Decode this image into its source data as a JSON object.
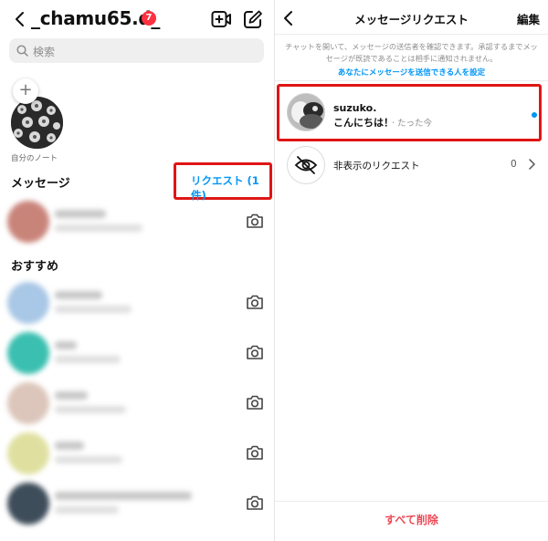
{
  "left_panel": {
    "username": "_chamu65.d_",
    "notification_count": "7",
    "search_placeholder": "検索",
    "note_label": "自分のノート",
    "messages_heading": "メッセージ",
    "requests_link": "リクエスト (1件)",
    "recommended_heading": "おすすめ",
    "message_rows": [
      {
        "avatar_color": "#c9847a",
        "name_width": 56,
        "msg_width": 96
      }
    ],
    "recommended_rows": [
      {
        "avatar_color": "#a9c7e6",
        "name_width": 52,
        "msg_width": 84
      },
      {
        "avatar_color": "#3bbfb0",
        "name_width": 24,
        "msg_width": 72
      },
      {
        "avatar_color": "#dcc6bb",
        "name_width": 36,
        "msg_width": 78
      },
      {
        "avatar_color": "#dfe0a0",
        "name_width": 32,
        "msg_width": 74
      },
      {
        "avatar_color": "#3e4d5a",
        "name_width": 150,
        "msg_width": 70
      }
    ]
  },
  "right_panel": {
    "title": "メッセージリクエスト",
    "edit_label": "編集",
    "info_text": "チャットを開いて、メッセージの送信者を確認できます。承認するまでメッセージが既読であることは相手に通知されません。",
    "settings_link": "あなたにメッセージを送信できる人を設定",
    "request": {
      "name": "suzuko.",
      "message": "こんにちは！",
      "time": "· たった今"
    },
    "hidden_requests_label": "非表示のリクエスト",
    "hidden_requests_count": "0",
    "delete_all_label": "すべて削除"
  },
  "colors": {
    "accent_blue": "#0095f6",
    "highlight_red": "#e01515",
    "delete_red": "#ed4956",
    "badge_red": "#ff3040"
  },
  "icons": [
    "chevron-left-icon",
    "video-plus-icon",
    "compose-icon",
    "search-icon",
    "camera-icon",
    "eye-off-icon",
    "chevron-right-icon"
  ]
}
